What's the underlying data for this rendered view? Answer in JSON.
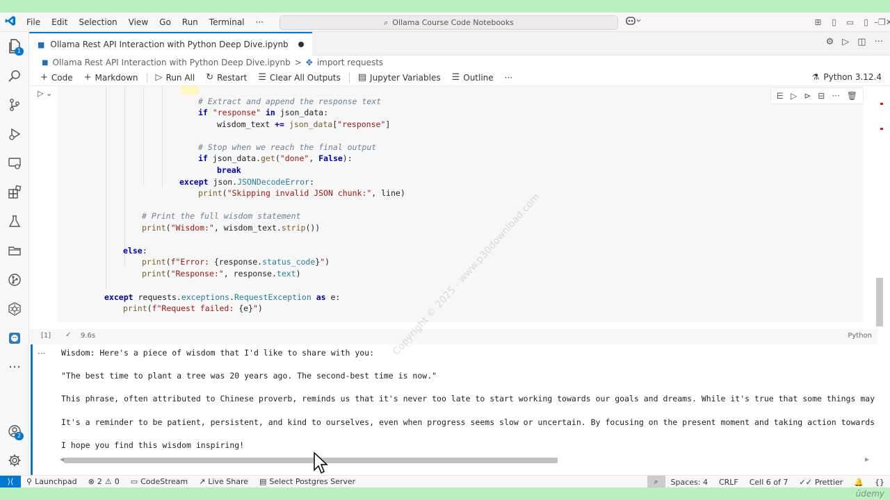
{
  "menu": {
    "items": [
      "File",
      "Edit",
      "Selection",
      "View",
      "Go",
      "Run",
      "Terminal",
      "···"
    ]
  },
  "search": {
    "label": "Ollama Course Code Notebooks"
  },
  "tab": {
    "title": "Ollama Rest API Interaction with Python Deep Dive.ipynb"
  },
  "breadcrumb": {
    "file": "Ollama Rest API Interaction with Python Deep Dive.ipynb",
    "separator": ">",
    "symbol": "import requests"
  },
  "toolbar": {
    "code": "Code",
    "markdown": "Markdown",
    "run_all": "Run All",
    "restart": "Restart",
    "clear_outputs": "Clear All Outputs",
    "jupyter_variables": "Jupyter Variables",
    "outline": "Outline",
    "more": "···",
    "kernel": "Python 3.12.4"
  },
  "code_lines": [
    "# Extract and append the response text",
    "if \"response\" in json_data:",
    "wisdom_text += json_data[\"response\"]",
    "# Stop when we reach the final output",
    "if json_data.get(\"done\", False):",
    "break",
    "except json.JSONDecodeError:",
    "print(\"Skipping invalid JSON chunk:\", line)",
    "# Print the full wisdom statement",
    "print(\"Wisdom:\", wisdom_text.strip())",
    "else:",
    "print(f\"Error: {response.status_code}\")",
    "print(\"Response:\", response.text)",
    "except requests.exceptions.RequestException as e:",
    "print(f\"Request failed: {e}\")"
  ],
  "cell_status": {
    "exec_count": "[1]",
    "check": "✓",
    "duration": "9.6s",
    "language": "Python"
  },
  "output": {
    "ellipsis": "···",
    "lines": [
      "Wisdom: Here's a piece of wisdom that I'd like to share with you:",
      "\"The best time to plant a tree was 20 years ago. The second-best time is now.\"",
      "This phrase, often attributed to Chinese proverb, reminds us that it's never too late to start working towards our goals and dreams. While it's true that some things may take t",
      "It's a reminder to be patient, persistent, and kind to ourselves, even when progress seems slow or uncertain. By focusing on the present moment and taking action towards our go",
      "I hope you find this wisdom inspiring!"
    ]
  },
  "activity": {
    "explorer_badge": "1",
    "accounts_badge": "2",
    "more": "···"
  },
  "status_bar": {
    "launchpad": "Launchpad",
    "errors": "2",
    "warnings": "0",
    "codestream": "CodeStream",
    "live_share": "Live Share",
    "postgres": "Select Postgres Server",
    "spaces": "Spaces: 4",
    "eol": "CRLF",
    "cell": "Cell 6 of 7",
    "prettier": "Prettier",
    "braces": "{}"
  },
  "watermark": "Copyright © 2025 - www.p30download.com",
  "brand": "ūdemy"
}
